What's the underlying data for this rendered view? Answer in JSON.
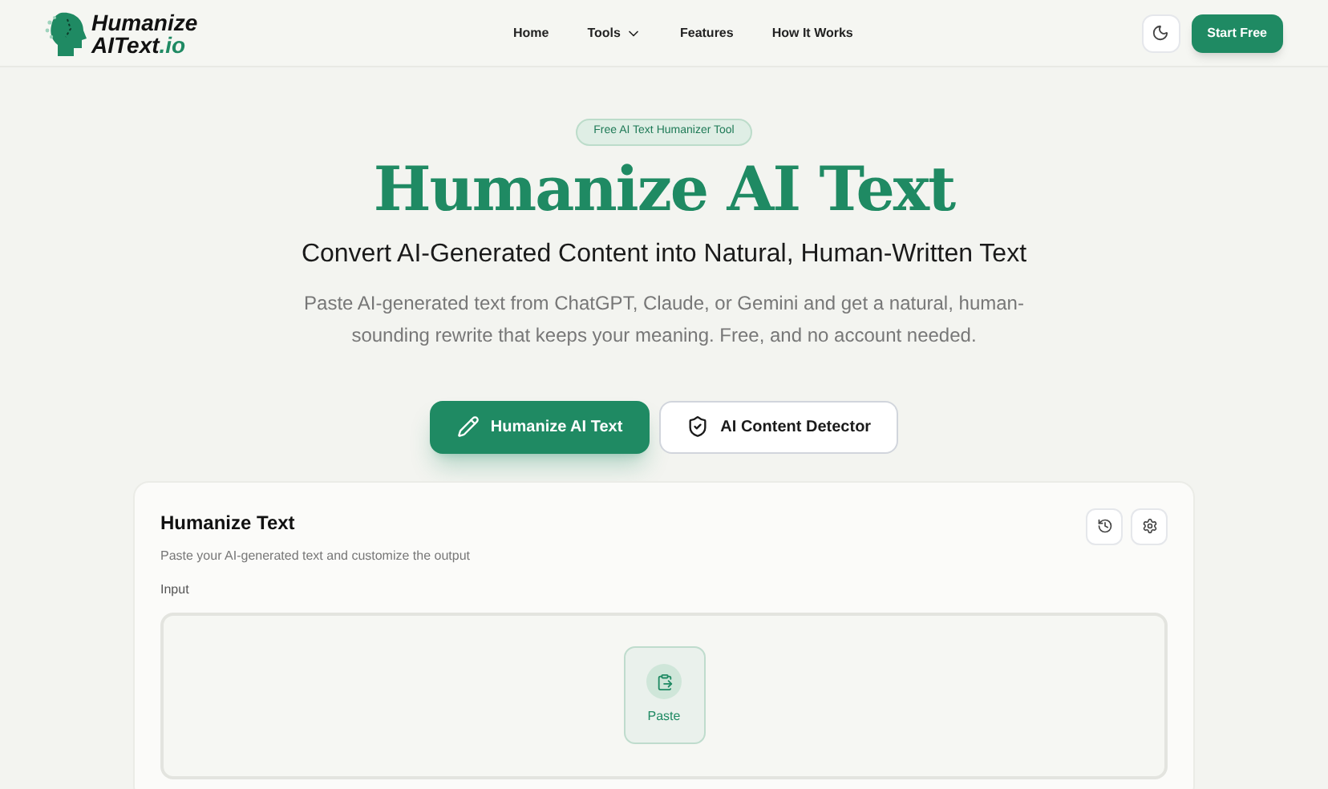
{
  "logo": {
    "line1": "Humanize",
    "line2": "AIText",
    "suffix": ".io"
  },
  "nav": [
    {
      "label": "Home",
      "dropdown": false
    },
    {
      "label": "Tools",
      "dropdown": true
    },
    {
      "label": "Features",
      "dropdown": false
    },
    {
      "label": "How It Works",
      "dropdown": false
    }
  ],
  "header_button": "Start Free",
  "hero": {
    "badge": "Free AI Text Humanizer Tool",
    "title": "Humanize AI Text",
    "subtitle": "Convert AI-Generated Content into Natural, Human-Written Text",
    "description": "Paste AI-generated text from ChatGPT, Claude, or Gemini and get a natural, human-sounding rewrite that keeps your meaning. Free, and no account needed."
  },
  "actions": [
    {
      "label": "Humanize AI Text",
      "kind": "primary"
    },
    {
      "label": "AI Content Detector",
      "kind": "secondary"
    }
  ],
  "card": {
    "title": "Humanize Text",
    "subtitle": "Paste your AI-generated text and customize the output",
    "input_label": "Input",
    "paste_button": "Paste"
  }
}
